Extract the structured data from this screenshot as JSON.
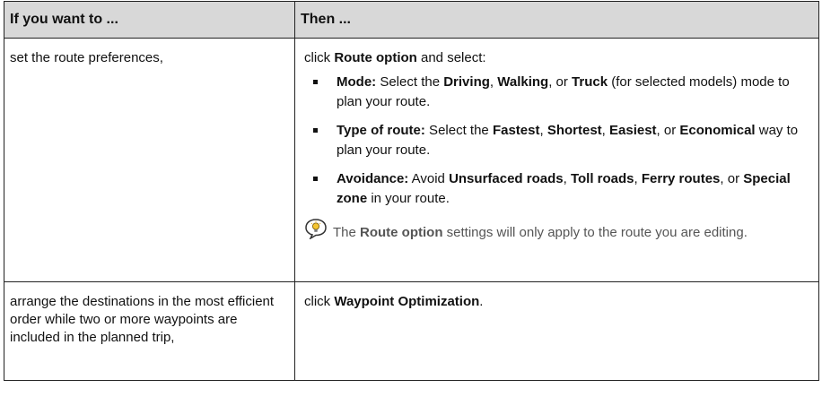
{
  "table": {
    "headers": [
      "If you want to ...",
      "Then ..."
    ],
    "row1": {
      "left": "set the route preferences,",
      "intro": "click ",
      "intro_bold": "Route option",
      "intro_tail": " and select:",
      "mode": {
        "label": "Mode:",
        "t1": " Select the ",
        "b1": "Driving",
        "t2": ", ",
        "b2": "Walking",
        "t3": ", or ",
        "b3": "Truck",
        "t4": " (for selected models) mode to plan your route."
      },
      "type": {
        "label": "Type of route:",
        "t1": " Select the ",
        "b1": "Fastest",
        "t2": ", ",
        "b2": "Shortest",
        "t3": ", ",
        "b3": "Easiest",
        "t4": ", or ",
        "b4": "Economical",
        "t5": " way to plan your route."
      },
      "avoid": {
        "label": "Avoidance:",
        "t1": " Avoid ",
        "b1": "Unsurfaced roads",
        "t2": ", ",
        "b2": "Toll roads",
        "t3": ", ",
        "b3": "Ferry routes",
        "t4": ", or ",
        "b4": "Special zone",
        "t5": " in your route."
      },
      "tip": {
        "icon": "lightbulb-tip-icon",
        "t1": "The ",
        "b1": "Route option",
        "t2": " settings will only apply to the route you are editing."
      }
    },
    "row2": {
      "left": "arrange the destinations in the most efficient order while two or more waypoints are included in the planned trip,",
      "t1": "click ",
      "b1": "Waypoint Optimization",
      "t2": "."
    }
  }
}
